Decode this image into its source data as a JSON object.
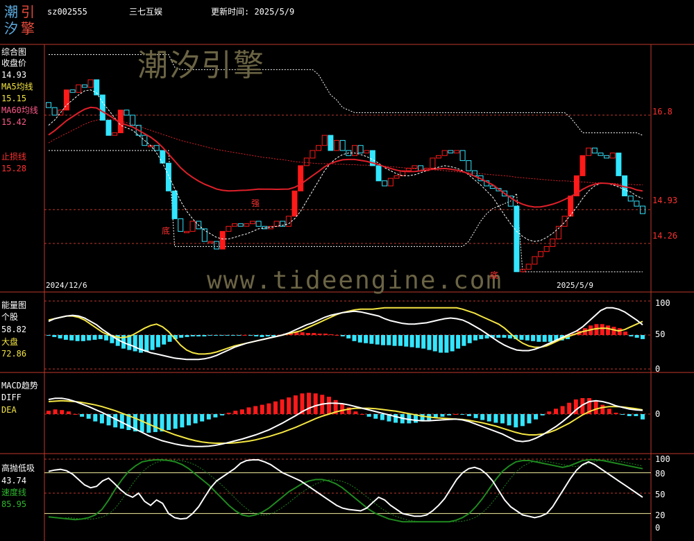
{
  "header": {
    "logo_chars": [
      "潮",
      "引",
      "汐",
      "擎"
    ],
    "code": "sz002555",
    "name": "三七互娱",
    "update_label": "更新时间: 2025/5/9"
  },
  "watermarks": {
    "brand": "潮汐引擎",
    "url": "www.tideengine.com"
  },
  "colors": {
    "bg": "#000000",
    "frame": "#c0392b",
    "up": "#ff1a1a",
    "down": "#33e6ff",
    "ma": "#e0202a",
    "stock_line": "#ffffff",
    "market_line": "#f5e642",
    "speed_line": "#1f8a1f"
  },
  "panels": {
    "main": {
      "title": "综合图",
      "close_label": "收盘价",
      "close_value": "14.93",
      "ma5_label": "MA5均线",
      "ma5_value": "15.15",
      "ma60_label": "MA60均线",
      "ma60_value": "15.42",
      "stop_label": "止损线",
      "stop_value": "15.28",
      "y_ticks": [
        "16.8",
        "14.93",
        "14.26"
      ],
      "date_start": "2024/12/6",
      "date_end": "2025/5/9",
      "marks": [
        "底",
        "强",
        "底"
      ]
    },
    "energy": {
      "title": "能量图",
      "stock_label": "个股",
      "stock_value": "58.82",
      "market_label": "大盘",
      "market_value": "72.86",
      "y_ticks": [
        "100",
        "50",
        "0"
      ]
    },
    "macd": {
      "title": "MACD趋势",
      "diff_label": "DIFF",
      "dea_label": "DEA",
      "y_ticks": [
        "0"
      ]
    },
    "osc": {
      "title": "高抛低吸",
      "value": "43.74",
      "speed_label": "速度线",
      "speed_value": "85.95",
      "y_ticks": [
        "100",
        "80",
        "50",
        "20",
        "0"
      ]
    }
  },
  "chart_data": [
    {
      "type": "candlestick",
      "title": "综合图",
      "ylim": [
        13.3,
        18.2
      ],
      "x_start_label": "2024/12/6",
      "x_end_label": "2025/5/9",
      "closes": [
        16.95,
        16.8,
        16.9,
        17.3,
        17.25,
        17.4,
        17.35,
        17.5,
        17.2,
        16.7,
        16.4,
        16.45,
        16.9,
        16.8,
        16.6,
        16.4,
        16.2,
        16.2,
        16.1,
        15.85,
        15.3,
        14.75,
        14.5,
        14.5,
        14.7,
        14.55,
        14.3,
        14.3,
        14.15,
        14.5,
        14.6,
        14.65,
        14.6,
        14.65,
        14.7,
        14.6,
        14.55,
        14.6,
        14.7,
        14.6,
        14.8,
        15.3,
        15.8,
        15.95,
        16.1,
        16.2,
        16.4,
        16.1,
        16.3,
        16.1,
        16.0,
        16.2,
        16.05,
        16.1,
        15.8,
        15.5,
        15.4,
        15.55,
        15.6,
        15.7,
        15.75,
        15.8,
        15.7,
        15.75,
        15.95,
        16.0,
        16.1,
        16.05,
        16.1,
        15.9,
        15.7,
        15.6,
        15.5,
        15.4,
        15.35,
        15.3,
        15.2,
        15.0,
        13.7,
        13.75,
        13.85,
        14.0,
        14.1,
        14.2,
        14.35,
        14.6,
        14.8,
        15.2,
        15.6,
        16.0,
        16.15,
        16.05,
        16.0,
        15.95,
        16.05,
        15.6,
        15.2,
        15.1,
        15.0,
        14.85
      ],
      "ma5": [
        16.6,
        16.7,
        16.85,
        17.0,
        17.1,
        17.2,
        17.28,
        17.3,
        17.24,
        17.05,
        16.9,
        16.75,
        16.6,
        16.55,
        16.5,
        16.4,
        16.3,
        16.2,
        16.05,
        15.85,
        15.6,
        15.35,
        15.1,
        14.9,
        14.75,
        14.62,
        14.52,
        14.45,
        14.38,
        14.35,
        14.35,
        14.38,
        14.42,
        14.45,
        14.5,
        14.55,
        14.57,
        14.58,
        14.6,
        14.62,
        14.65,
        14.75,
        14.9,
        15.1,
        15.3,
        15.5,
        15.7,
        15.85,
        15.95,
        16.02,
        16.05,
        16.05,
        16.02,
        15.98,
        15.92,
        15.85,
        15.76,
        15.7,
        15.64,
        15.6,
        15.6,
        15.62,
        15.66,
        15.7,
        15.74,
        15.77,
        15.8,
        15.78,
        15.75,
        15.7,
        15.62,
        15.52,
        15.42,
        15.3,
        15.18,
        15.0,
        14.82,
        14.65,
        14.5,
        14.4,
        14.33,
        14.3,
        14.32,
        14.38,
        14.46,
        14.56,
        14.68,
        14.82,
        14.98,
        15.15,
        15.3,
        15.4,
        15.45,
        15.45,
        15.42,
        15.38,
        15.32,
        15.28,
        15.2,
        15.15
      ],
      "ma60": [
        16.25,
        16.32,
        16.38,
        16.44,
        16.5,
        16.56,
        16.62,
        16.67,
        16.7,
        16.72,
        16.72,
        16.7,
        16.68,
        16.65,
        16.62,
        16.58,
        16.54,
        16.5,
        16.46,
        16.42,
        16.38,
        16.34,
        16.3,
        16.27,
        16.24,
        16.21,
        16.18,
        16.15,
        16.12,
        16.1,
        16.08,
        16.06,
        16.04,
        16.02,
        16.0,
        15.98,
        15.96,
        15.95,
        15.93,
        15.92,
        15.9,
        15.88,
        15.87,
        15.86,
        15.85,
        15.84,
        15.84,
        15.84,
        15.83,
        15.83,
        15.82,
        15.82,
        15.81,
        15.81,
        15.8,
        15.8,
        15.79,
        15.78,
        15.77,
        15.76,
        15.75,
        15.74,
        15.73,
        15.72,
        15.72,
        15.71,
        15.7,
        15.69,
        15.68,
        15.67,
        15.66,
        15.65,
        15.64,
        15.63,
        15.62,
        15.61,
        15.6,
        15.59,
        15.57,
        15.56,
        15.55,
        15.54,
        15.53,
        15.52,
        15.51,
        15.5,
        15.5,
        15.49,
        15.48,
        15.48,
        15.47,
        15.46,
        15.46,
        15.45,
        15.45,
        15.44,
        15.43,
        15.43,
        15.42,
        15.42
      ],
      "upper_band": [
        18.0,
        18.0,
        18.0,
        18.0,
        18.0,
        18.0,
        18.0,
        18.0,
        18.0,
        18.0,
        18.0,
        18.0,
        18.0,
        18.0,
        18.0,
        18.0,
        18.0,
        18.0,
        18.0,
        18.0,
        18.0,
        17.75,
        17.7,
        17.7,
        17.7,
        17.7,
        17.7,
        17.7,
        17.7,
        17.7,
        17.7,
        17.7,
        17.7,
        17.7,
        17.7,
        17.7,
        17.7,
        17.7,
        17.7,
        17.7,
        17.7,
        17.7,
        17.7,
        17.7,
        17.7,
        17.6,
        17.4,
        17.2,
        17.1,
        16.95,
        16.9,
        16.85,
        16.85,
        16.85,
        16.85,
        16.85,
        16.85,
        16.85,
        16.85,
        16.85,
        16.85,
        16.85,
        16.85,
        16.85,
        16.85,
        16.85,
        16.85,
        16.85,
        16.85,
        16.85,
        16.85,
        16.85,
        16.85,
        16.85,
        16.85,
        16.85,
        16.85,
        16.85,
        16.85,
        16.85,
        16.85,
        16.85,
        16.85,
        16.85,
        16.85,
        16.85,
        16.85,
        16.75,
        16.6,
        16.45,
        16.45,
        16.45,
        16.45,
        16.45,
        16.45,
        16.45,
        16.45,
        16.45,
        16.45,
        16.4
      ],
      "lower_band": [
        16.1,
        16.1,
        16.1,
        16.1,
        16.1,
        16.1,
        16.1,
        16.1,
        16.1,
        16.1,
        16.1,
        16.1,
        16.1,
        16.1,
        16.1,
        16.1,
        16.1,
        16.1,
        16.1,
        16.1,
        16.1,
        14.2,
        14.2,
        14.2,
        14.2,
        14.2,
        14.2,
        14.2,
        14.2,
        14.2,
        14.2,
        14.2,
        14.2,
        14.2,
        14.2,
        14.2,
        14.2,
        14.2,
        14.2,
        14.2,
        14.2,
        14.2,
        14.2,
        14.2,
        14.2,
        14.2,
        14.2,
        14.2,
        14.2,
        14.2,
        14.2,
        14.2,
        14.2,
        14.2,
        14.2,
        14.2,
        14.2,
        14.2,
        14.2,
        14.2,
        14.2,
        14.2,
        14.2,
        14.2,
        14.2,
        14.2,
        14.2,
        14.2,
        14.2,
        14.2,
        14.3,
        14.5,
        14.7,
        14.85,
        14.95,
        15.0,
        15.05,
        15.1,
        15.25,
        13.7,
        13.7,
        13.7,
        13.7,
        13.7,
        13.7,
        13.7,
        13.7,
        13.7,
        13.7,
        13.7,
        13.7,
        13.7,
        13.7,
        13.7,
        13.7,
        13.7,
        13.7,
        13.7,
        13.7,
        13.7
      ],
      "stop_line": 14.26
    },
    {
      "type": "bar+line",
      "title": "能量图",
      "ylim": [
        0,
        100
      ],
      "stock": [
        70,
        74,
        76,
        78,
        79,
        78,
        75,
        70,
        65,
        58,
        52,
        46,
        41,
        37,
        34,
        30,
        27,
        24,
        22,
        20,
        18,
        16,
        15,
        14,
        14,
        14,
        15,
        17,
        20,
        24,
        28,
        32,
        35,
        38,
        40,
        42,
        44,
        46,
        48,
        50,
        53,
        57,
        61,
        65,
        68,
        72,
        76,
        79,
        81,
        83,
        84,
        85,
        84,
        82,
        80,
        78,
        74,
        71,
        69,
        67,
        66,
        66,
        67,
        68,
        70,
        72,
        74,
        75,
        74,
        72,
        68,
        63,
        58,
        52,
        46,
        40,
        35,
        31,
        28,
        27,
        27,
        29,
        32,
        36,
        40,
        44,
        48,
        52,
        56,
        62,
        70,
        78,
        86,
        90,
        90,
        88,
        84,
        78,
        72,
        65
      ],
      "market": [
        72,
        74,
        76,
        78,
        78,
        76,
        72,
        66,
        60,
        54,
        50,
        48,
        46,
        47,
        50,
        55,
        60,
        64,
        66,
        62,
        55,
        45,
        35,
        28,
        24,
        22,
        22,
        23,
        25,
        28,
        31,
        34,
        36,
        38,
        40,
        42,
        44,
        46,
        48,
        50,
        52,
        54,
        56,
        60,
        64,
        68,
        72,
        76,
        80,
        83,
        85,
        87,
        88,
        88,
        88,
        89,
        90,
        90,
        90,
        90,
        90,
        90,
        90,
        90,
        90,
        90,
        90,
        90,
        90,
        88,
        85,
        82,
        78,
        74,
        70,
        66,
        60,
        52,
        44,
        38,
        34,
        32,
        32,
        34,
        38,
        42,
        46,
        49,
        52,
        55,
        57,
        59,
        60,
        60,
        58,
        56,
        58,
        62,
        66,
        70
      ],
      "bars": [
        -1,
        -3,
        -5,
        -7,
        -8,
        -9,
        -9,
        -8,
        -7,
        -6,
        -8,
        -12,
        -16,
        -20,
        -22,
        -24,
        -26,
        -25,
        -22,
        -18,
        -14,
        -10,
        -6,
        -4,
        -3,
        -2,
        -2,
        -2,
        -1,
        -1,
        -1,
        -1,
        -1,
        -1,
        0,
        -1,
        -2,
        -3,
        -2,
        -2,
        0,
        2,
        3,
        4,
        4,
        3,
        3,
        2,
        2,
        1,
        0,
        -2,
        -5,
        -9,
        -11,
        -12,
        -13,
        -14,
        -15,
        -15,
        -16,
        -16,
        -17,
        -18,
        -19,
        -20,
        -22,
        -24,
        -26,
        -26,
        -24,
        -20,
        -16,
        -12,
        -8,
        -6,
        -5,
        -4,
        -4,
        -4,
        -5,
        -6,
        -7,
        -8,
        -9,
        -10,
        -10,
        -10,
        -9,
        -8,
        -6,
        2,
        6,
        10,
        14,
        16,
        16,
        14,
        12,
        10,
        5,
        -2,
        -4,
        -6
      ]
    },
    {
      "type": "bar+line",
      "title": "MACD趋势",
      "ylim": [
        -1.0,
        1.0
      ],
      "diff": [
        0.35,
        0.38,
        0.38,
        0.35,
        0.3,
        0.24,
        0.18,
        0.11,
        0.04,
        -0.04,
        -0.12,
        -0.2,
        -0.28,
        -0.36,
        -0.44,
        -0.52,
        -0.58,
        -0.64,
        -0.68,
        -0.72,
        -0.75,
        -0.77,
        -0.78,
        -0.78,
        -0.77,
        -0.75,
        -0.72,
        -0.68,
        -0.64,
        -0.6,
        -0.55,
        -0.5,
        -0.44,
        -0.38,
        -0.3,
        -0.22,
        -0.13,
        -0.04,
        0.06,
        0.14,
        0.2,
        0.24,
        0.26,
        0.26,
        0.25,
        0.22,
        0.18,
        0.14,
        0.1,
        0.06,
        0.02,
        -0.02,
        -0.06,
        -0.1,
        -0.13,
        -0.15,
        -0.16,
        -0.16,
        -0.15,
        -0.14,
        -0.13,
        -0.12,
        -0.14,
        -0.18,
        -0.24,
        -0.3,
        -0.36,
        -0.42,
        -0.48,
        -0.56,
        -0.64,
        -0.66,
        -0.64,
        -0.58,
        -0.5,
        -0.4,
        -0.3,
        -0.18,
        -0.05,
        0.1,
        0.22,
        0.3,
        0.32,
        0.3,
        0.26,
        0.2,
        0.16,
        0.12,
        0.1,
        0.09
      ],
      "dea": [
        0.3,
        0.31,
        0.32,
        0.31,
        0.3,
        0.28,
        0.25,
        0.22,
        0.18,
        0.13,
        0.08,
        0.02,
        -0.04,
        -0.1,
        -0.17,
        -0.24,
        -0.31,
        -0.38,
        -0.44,
        -0.5,
        -0.55,
        -0.6,
        -0.64,
        -0.67,
        -0.69,
        -0.7,
        -0.7,
        -0.7,
        -0.69,
        -0.67,
        -0.65,
        -0.62,
        -0.58,
        -0.54,
        -0.49,
        -0.44,
        -0.38,
        -0.32,
        -0.25,
        -0.18,
        -0.11,
        -0.05,
        0.0,
        0.05,
        0.09,
        0.12,
        0.14,
        0.14,
        0.14,
        0.13,
        0.11,
        0.09,
        0.07,
        0.04,
        0.01,
        -0.02,
        -0.05,
        -0.07,
        -0.09,
        -0.1,
        -0.11,
        -0.12,
        -0.13,
        -0.15,
        -0.18,
        -0.21,
        -0.25,
        -0.29,
        -0.34,
        -0.39,
        -0.44,
        -0.48,
        -0.5,
        -0.5,
        -0.48,
        -0.44,
        -0.38,
        -0.3,
        -0.22,
        -0.12,
        -0.02,
        0.06,
        0.12,
        0.16,
        0.18,
        0.18,
        0.17,
        0.15,
        0.13,
        0.1
      ],
      "hist": [
        0.05,
        0.07,
        0.06,
        0.04,
        0.0,
        -0.04,
        -0.07,
        -0.11,
        -0.14,
        -0.17,
        -0.2,
        -0.22,
        -0.24,
        -0.26,
        -0.27,
        -0.28,
        -0.27,
        -0.26,
        -0.24,
        -0.22,
        -0.2,
        -0.17,
        -0.14,
        -0.11,
        -0.08,
        -0.05,
        -0.02,
        0.02,
        0.05,
        0.07,
        0.1,
        0.12,
        0.14,
        0.16,
        0.19,
        0.22,
        0.25,
        0.28,
        0.31,
        0.32,
        0.31,
        0.29,
        0.26,
        0.21,
        0.16,
        0.1,
        0.04,
        0.0,
        -0.04,
        -0.07,
        -0.09,
        -0.11,
        -0.13,
        -0.14,
        -0.14,
        -0.13,
        -0.11,
        -0.09,
        -0.06,
        -0.04,
        -0.02,
        0.0,
        -0.01,
        -0.03,
        -0.06,
        -0.09,
        -0.11,
        -0.13,
        -0.14,
        -0.17,
        -0.2,
        -0.18,
        -0.14,
        -0.08,
        -0.02,
        0.04,
        0.08,
        0.12,
        0.17,
        0.22,
        0.24,
        0.24,
        0.2,
        0.14,
        0.08,
        0.02,
        -0.01,
        -0.03,
        -0.03,
        -0.08
      ]
    },
    {
      "type": "line",
      "title": "高抛低吸",
      "ylim": [
        0,
        100
      ],
      "reference_lines": [
        80,
        50,
        20
      ],
      "value": [
        82,
        84,
        85,
        83,
        78,
        70,
        62,
        58,
        60,
        68,
        72,
        64,
        55,
        48,
        44,
        50,
        38,
        32,
        40,
        35,
        20,
        14,
        12,
        13,
        20,
        30,
        44,
        58,
        68,
        74,
        80,
        86,
        94,
        98,
        99,
        99,
        96,
        92,
        86,
        80,
        76,
        72,
        68,
        62,
        56,
        50,
        44,
        38,
        32,
        28,
        26,
        25,
        24,
        28,
        36,
        44,
        40,
        32,
        26,
        20,
        18,
        16,
        16,
        18,
        24,
        32,
        42,
        56,
        70,
        80,
        86,
        88,
        85,
        78,
        68,
        54,
        40,
        30,
        24,
        18,
        16,
        14,
        16,
        20,
        30,
        44,
        58,
        72,
        84,
        92,
        96,
        92,
        86,
        80,
        74,
        68,
        62,
        56,
        50,
        44
      ],
      "speed": [
        15,
        14,
        13,
        12,
        11,
        12,
        14,
        18,
        26,
        40,
        56,
        70,
        82,
        90,
        96,
        98,
        99,
        99,
        98,
        96,
        92,
        86,
        78,
        70,
        62,
        52,
        42,
        32,
        24,
        18,
        16,
        18,
        22,
        28,
        36,
        44,
        52,
        58,
        64,
        68,
        70,
        70,
        68,
        64,
        58,
        50,
        42,
        34,
        26,
        20,
        16,
        12,
        10,
        8,
        8,
        8,
        8,
        8,
        8,
        8,
        8,
        10,
        14,
        20,
        30,
        42,
        56,
        70,
        82,
        90,
        96,
        98,
        98,
        96,
        94,
        92,
        90,
        88,
        90,
        94,
        98,
        99,
        99,
        98,
        96,
        94,
        92,
        90,
        88,
        86
      ]
    }
  ]
}
